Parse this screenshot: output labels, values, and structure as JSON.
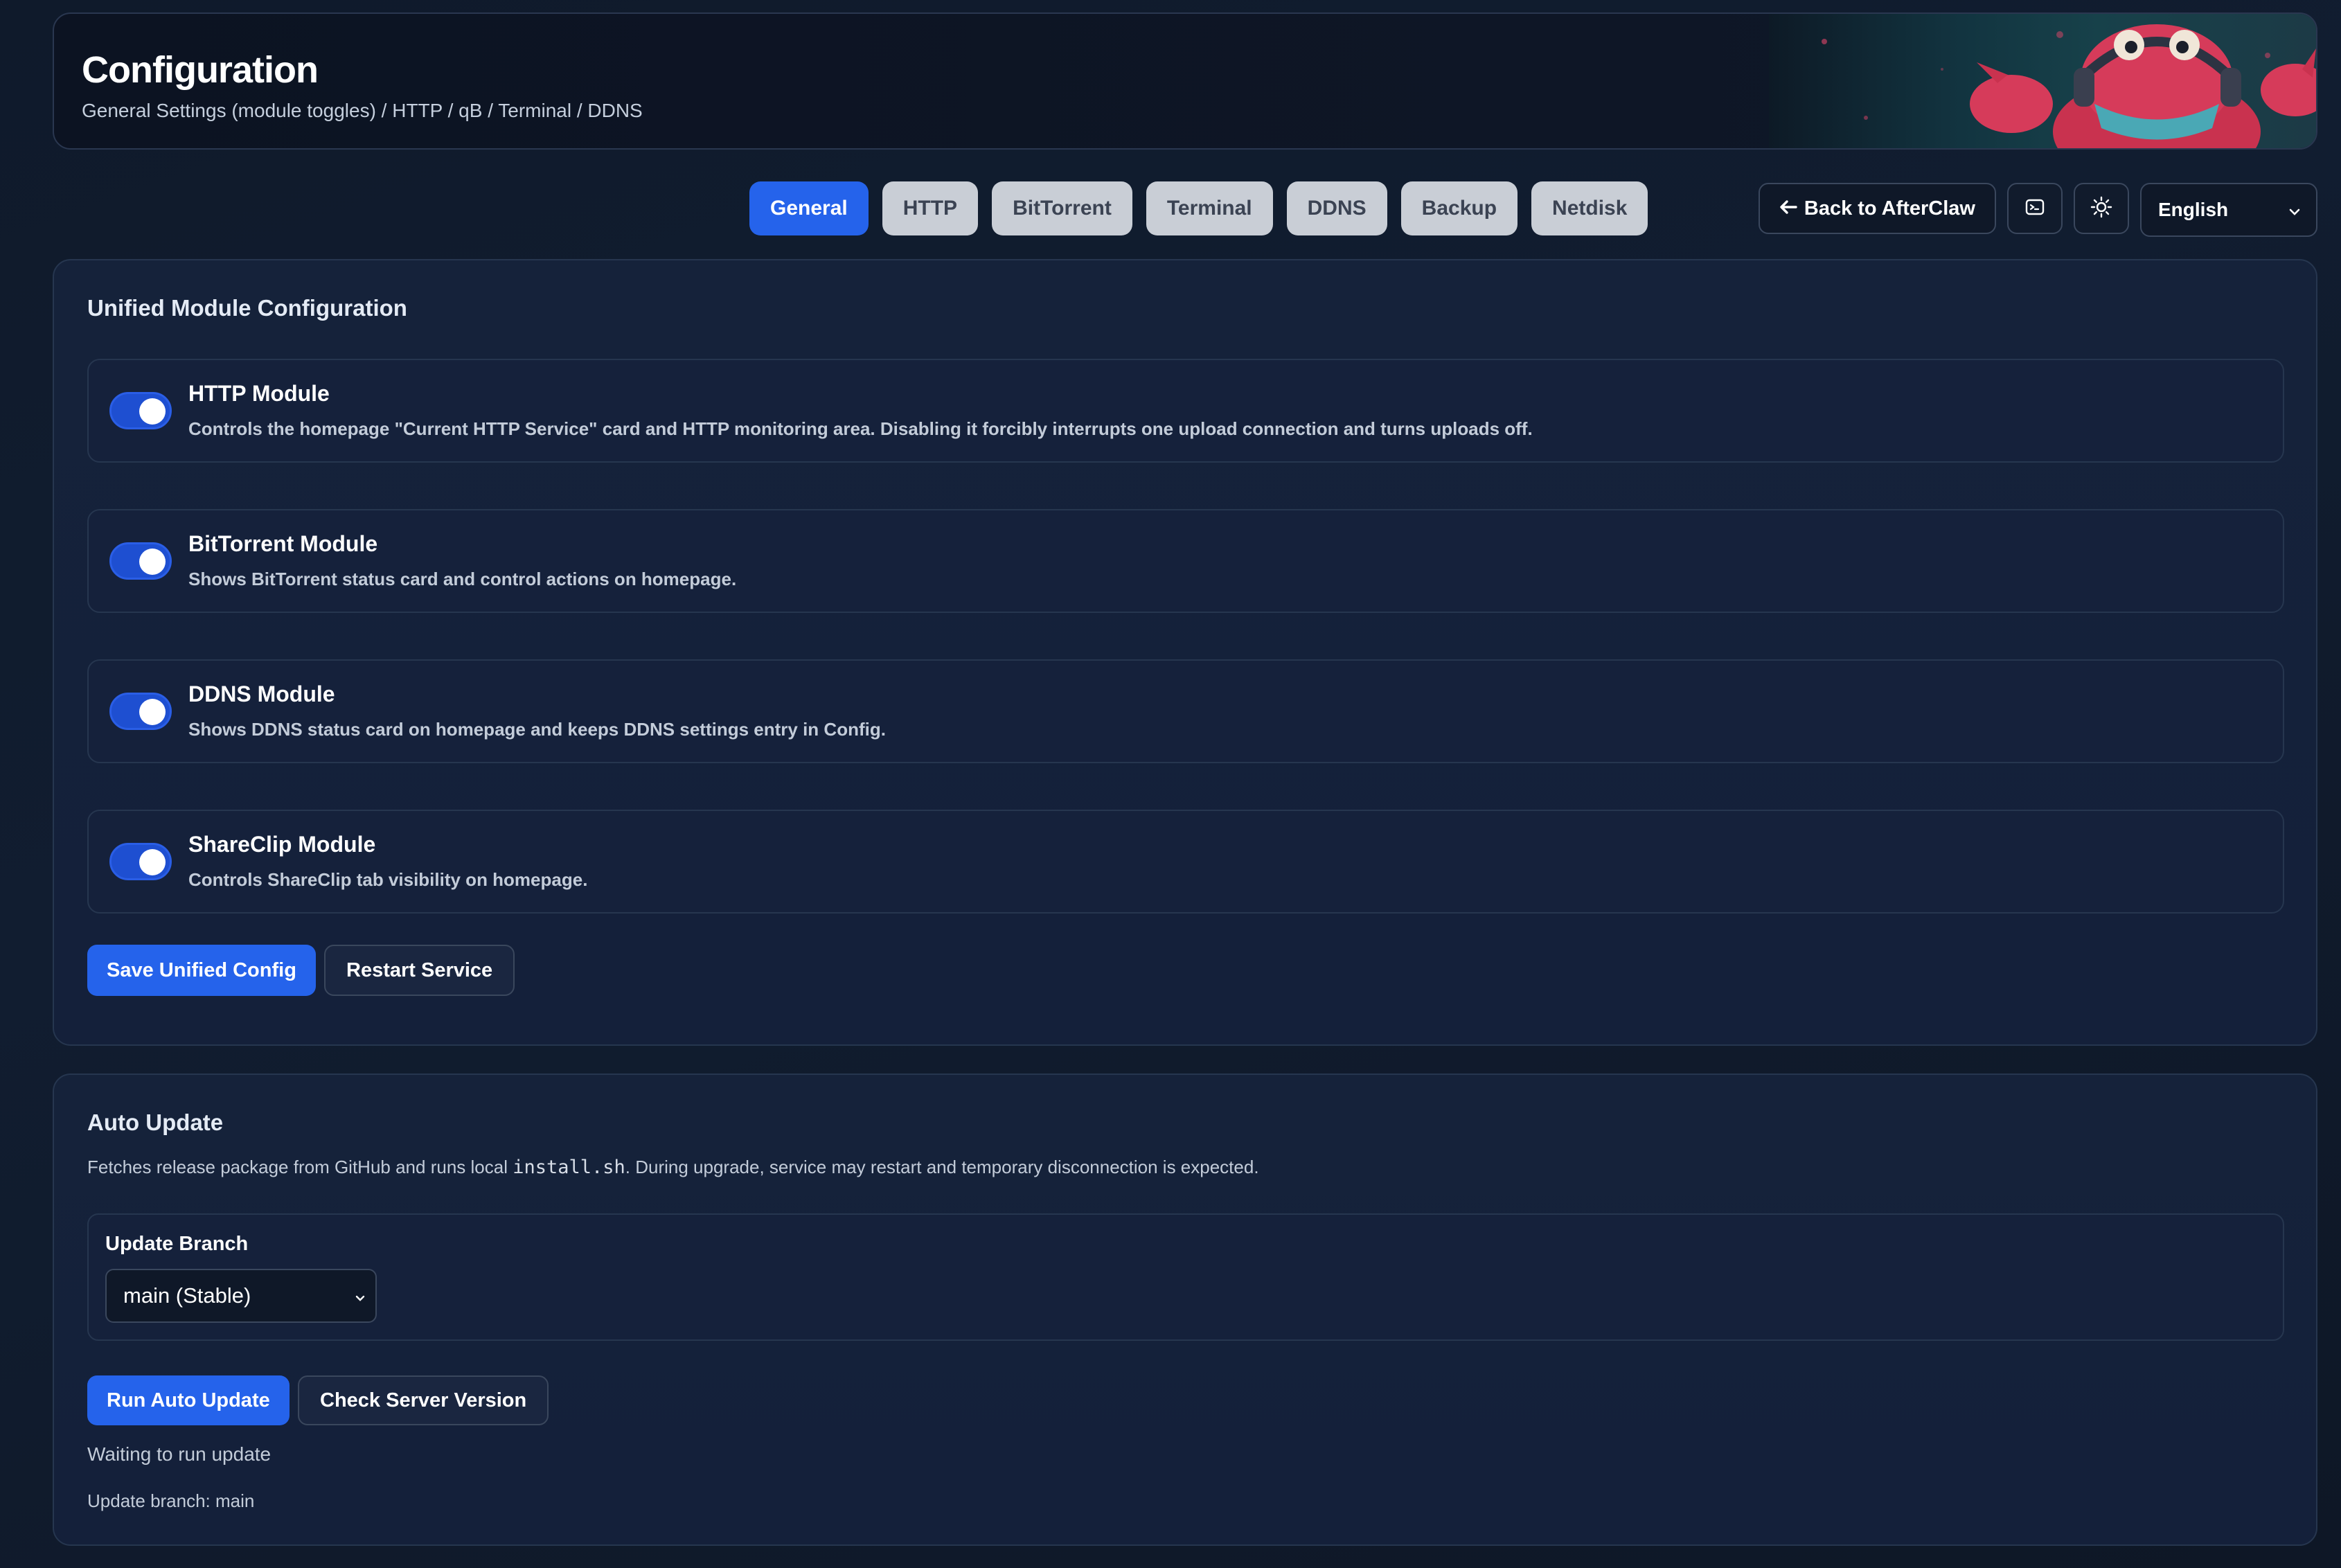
{
  "header": {
    "title": "Configuration",
    "subtitle": "General Settings (module toggles) / HTTP / qB / Terminal / DDNS"
  },
  "tabs": [
    {
      "label": "General",
      "active": true
    },
    {
      "label": "HTTP",
      "active": false
    },
    {
      "label": "BitTorrent",
      "active": false
    },
    {
      "label": "Terminal",
      "active": false
    },
    {
      "label": "DDNS",
      "active": false
    },
    {
      "label": "Backup",
      "active": false
    },
    {
      "label": "Netdisk",
      "active": false
    }
  ],
  "toolbar": {
    "back_label": "Back to AfterClaw",
    "back_icon": "arrow-left-icon",
    "terminal_icon": "terminal-icon",
    "theme_icon": "sun-icon",
    "language": "English"
  },
  "modules_card": {
    "title": "Unified Module Configuration",
    "modules": [
      {
        "name": "HTTP Module",
        "enabled": true,
        "description": "Controls the homepage \"Current HTTP Service\" card and HTTP monitoring area. Disabling it forcibly interrupts one upload connection and turns uploads off."
      },
      {
        "name": "BitTorrent Module",
        "enabled": true,
        "description": "Shows BitTorrent status card and control actions on homepage."
      },
      {
        "name": "DDNS Module",
        "enabled": true,
        "description": "Shows DDNS status card on homepage and keeps DDNS settings entry in Config."
      },
      {
        "name": "ShareClip Module",
        "enabled": true,
        "description": "Controls ShareClip tab visibility on homepage."
      }
    ],
    "save_label": "Save Unified Config",
    "restart_label": "Restart Service"
  },
  "update_card": {
    "title": "Auto Update",
    "desc_before": "Fetches release package from GitHub and runs local ",
    "desc_code": "install.sh",
    "desc_after": ". During upgrade, service may restart and temporary disconnection is expected.",
    "branch_label": "Update Branch",
    "branch_value": "main (Stable)",
    "run_label": "Run Auto Update",
    "check_label": "Check Server Version",
    "status": "Waiting to run update",
    "branch_info": "Update branch: main"
  },
  "colors": {
    "accent": "#2563eb",
    "background": "#0f1a2b",
    "card": "#15223a",
    "tab_inactive": "#c9ced6"
  }
}
